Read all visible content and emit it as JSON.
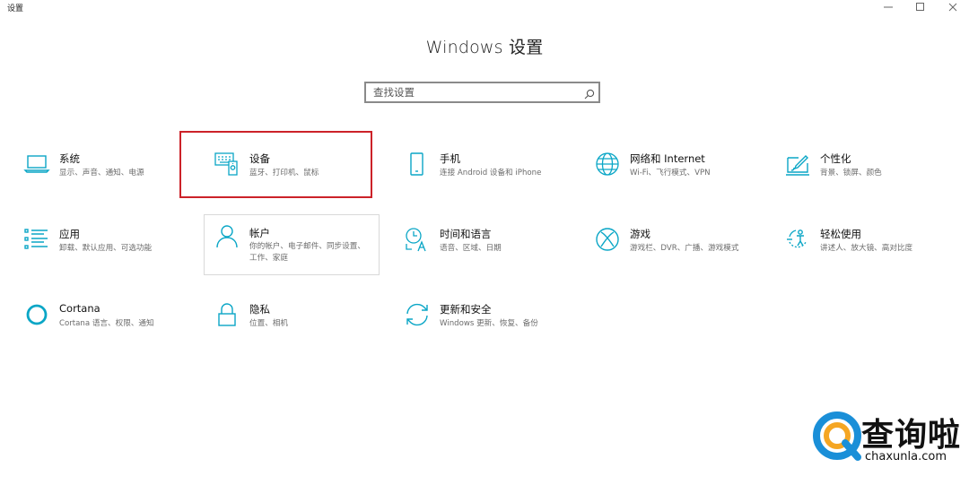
{
  "window": {
    "title": "设置"
  },
  "header": {
    "title": "Windows 设置"
  },
  "search": {
    "placeholder": "查找设置"
  },
  "accent_color": "#0aa6c6",
  "highlight_color": "#cc2229",
  "tiles": [
    {
      "name": "系统",
      "desc": "显示、声音、通知、电源",
      "icon": "laptop-icon"
    },
    {
      "name": "设备",
      "desc": "蓝牙、打印机、鼠标",
      "icon": "devices-icon"
    },
    {
      "name": "手机",
      "desc": "连接 Android 设备和 iPhone",
      "icon": "phone-icon"
    },
    {
      "name": "网络和 Internet",
      "desc": "Wi-Fi、飞行模式、VPN",
      "icon": "globe-icon"
    },
    {
      "name": "个性化",
      "desc": "背景、锁屏、颜色",
      "icon": "paint-icon"
    },
    {
      "name": "应用",
      "desc": "卸载、默认应用、可选功能",
      "icon": "apps-list-icon"
    },
    {
      "name": "帐户",
      "desc": "你的帐户、电子邮件、同步设置、工作、家庭",
      "icon": "person-icon"
    },
    {
      "name": "时间和语言",
      "desc": "语音、区域、日期",
      "icon": "time-language-icon"
    },
    {
      "name": "游戏",
      "desc": "游戏栏、DVR、广播、游戏模式",
      "icon": "xbox-icon"
    },
    {
      "name": "轻松使用",
      "desc": "讲述人、放大镜、高对比度",
      "icon": "ease-of-access-icon"
    },
    {
      "name": "Cortana",
      "desc": "Cortana 语言、权限、通知",
      "icon": "cortana-icon"
    },
    {
      "name": "隐私",
      "desc": "位置、相机",
      "icon": "lock-icon"
    },
    {
      "name": "更新和安全",
      "desc": "Windows 更新、恢复、备份",
      "icon": "sync-icon"
    }
  ],
  "watermark": {
    "text": "查询啦",
    "url": "chaxunla.com"
  }
}
